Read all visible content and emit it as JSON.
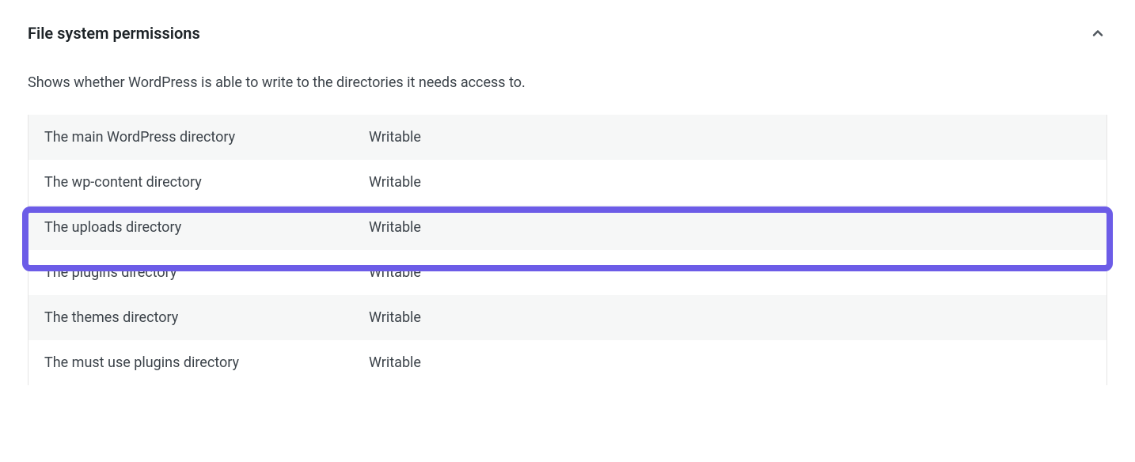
{
  "section": {
    "title": "File system permissions",
    "description": "Shows whether WordPress is able to write to the directories it needs access to."
  },
  "rows": [
    {
      "label": "The main WordPress directory",
      "value": "Writable"
    },
    {
      "label": "The wp-content directory",
      "value": "Writable"
    },
    {
      "label": "The uploads directory",
      "value": "Writable"
    },
    {
      "label": "The plugins directory",
      "value": "Writable"
    },
    {
      "label": "The themes directory",
      "value": "Writable"
    },
    {
      "label": "The must use plugins directory",
      "value": "Writable"
    }
  ],
  "highlighted_index": 2
}
